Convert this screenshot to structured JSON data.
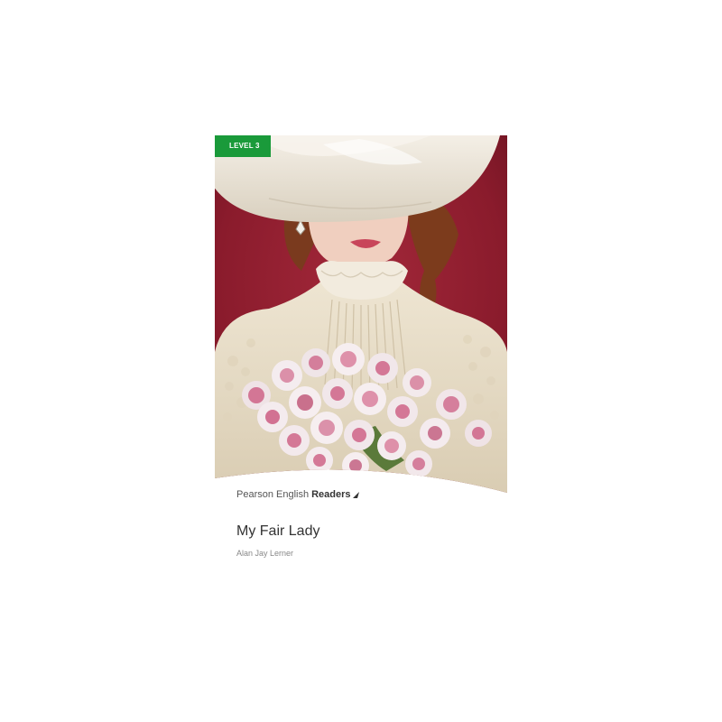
{
  "cover": {
    "level_badge": "LEVEL 3",
    "series_brand": "Pearson English",
    "series_name": "Readers",
    "title": "My Fair Lady",
    "author": "Alan Jay Lerner",
    "illustration_icon": "portrait-woman-hat-bouquet-icon",
    "series_mark_icon": "arrow-mark-icon"
  },
  "colors": {
    "level_badge": "#1a9a3a",
    "background_red": "#8e1d2e",
    "hat_cream": "#ece6da",
    "dress_cream": "#e6dcc6",
    "flower_pink": "#c9527a",
    "title_text": "#333333",
    "author_text": "#888888"
  }
}
